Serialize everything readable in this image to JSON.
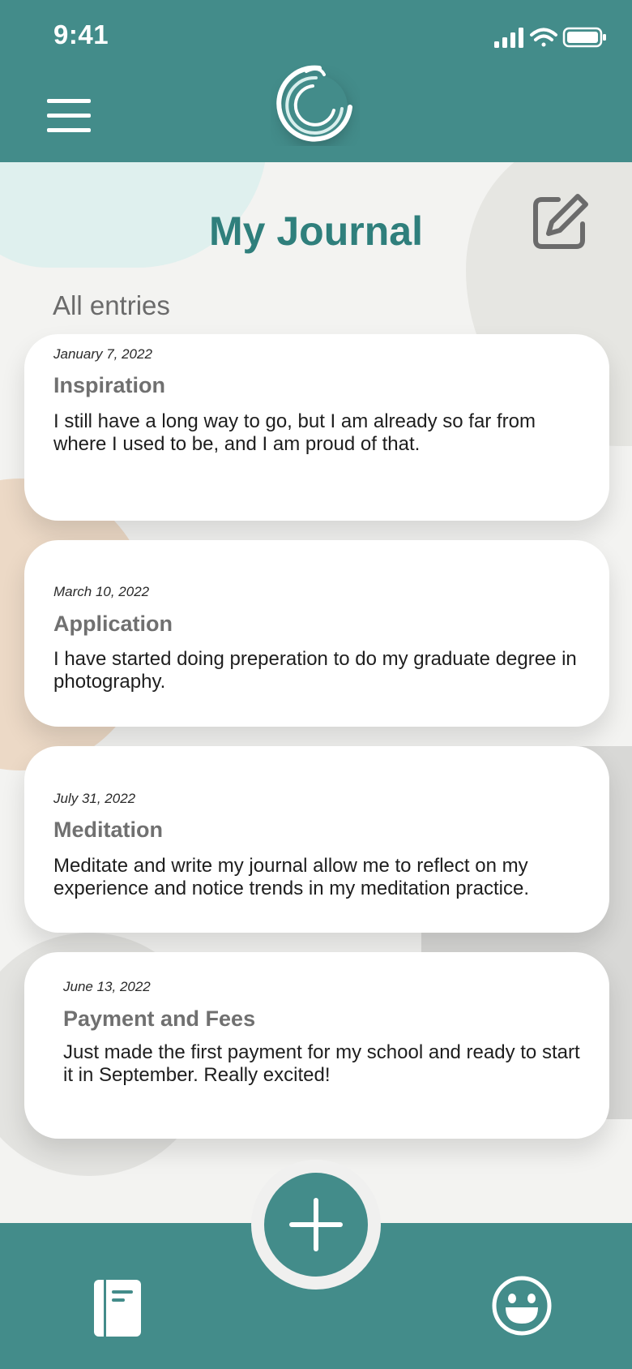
{
  "status_bar": {
    "time": "9:41"
  },
  "header": {
    "menu_icon": "hamburger-menu-icon",
    "logo_icon": "app-logo-swirl-icon"
  },
  "page": {
    "title": "My Journal",
    "section_label": "All entries",
    "edit_icon": "edit-pencil-icon"
  },
  "entries": [
    {
      "date": "January 7, 2022",
      "title": "Inspiration",
      "text": "I still have a long way to go, but I am already so far from where I used to be, and I am proud of that."
    },
    {
      "date": "March 10, 2022",
      "title": "Application",
      "text": "I have started doing preperation to do my graduate degree in photography."
    },
    {
      "date": "July 31, 2022",
      "title": "Meditation",
      "text": "Meditate and write my journal allow me to reflect on my experience and notice trends in my meditation practice."
    },
    {
      "date": "June 13, 2022",
      "title": "Payment and Fees",
      "text": "Just made the first payment for my school and ready to start it in September. Really excited!"
    }
  ],
  "bottom_nav": {
    "journal_icon": "journal-book-icon",
    "add_icon": "plus-icon",
    "mood_icon": "smiley-face-icon"
  },
  "colors": {
    "brand_teal": "#438c8a",
    "title_teal": "#2f7f7c",
    "card_bg": "#ffffff",
    "entry_title_grey": "#707070"
  }
}
